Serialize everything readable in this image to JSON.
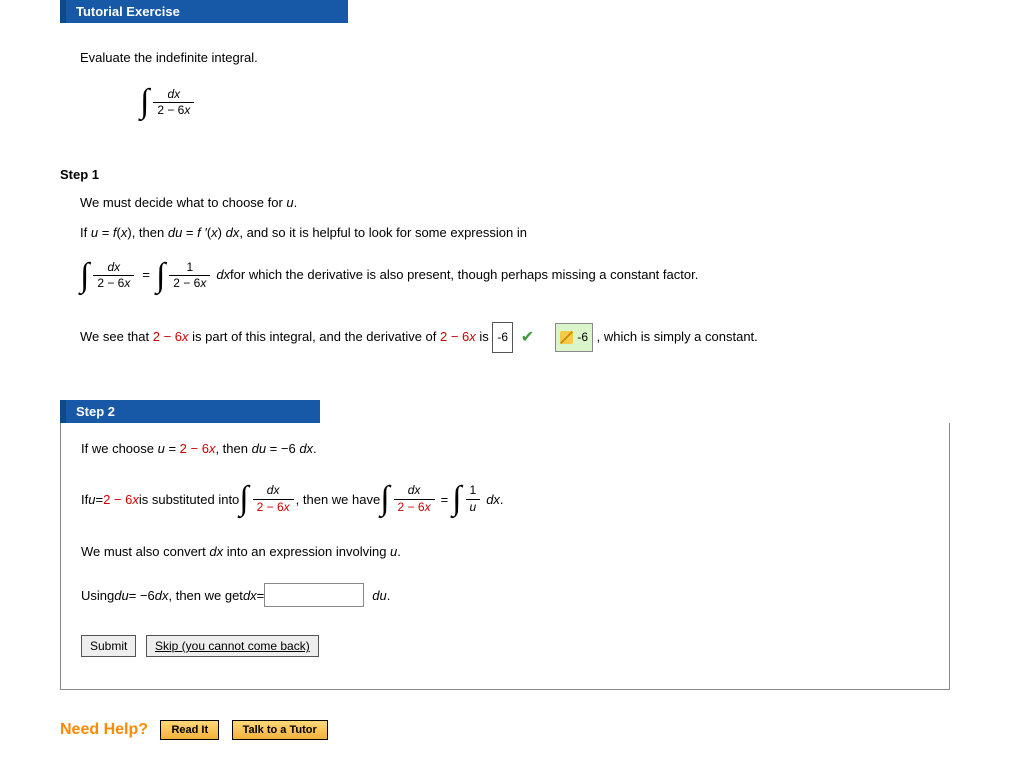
{
  "header": {
    "title": "Tutorial Exercise"
  },
  "intro": {
    "prompt": "Evaluate the indefinite integral.",
    "integral_num": "dx",
    "integral_den_a": "2 − 6",
    "integral_den_x": "x"
  },
  "step1": {
    "label": "Step 1",
    "p1_a": "We must decide what to choose for ",
    "p1_u": "u",
    "p1_b": ".",
    "p2_a": "If  ",
    "p2_u": "u",
    "p2_eq": " = ",
    "p2_f": "f",
    "p2_paren": "(",
    "p2_x": "x",
    "p2_close": "),  then  ",
    "p2_du": "du",
    "p2_eq2": " = ",
    "p2_fp": "f ′",
    "p2_paren2": "(",
    "p2_x2": "x",
    "p2_close2": ") ",
    "p2_dx": "dx",
    "p2_tail": ",  and so it is helpful to look for some expression in",
    "int1_num": "dx",
    "int1_den_a": "2 − 6",
    "int1_den_x": "x",
    "eq_middle": " = ",
    "int2_num": "1",
    "int2_den_a": "2 − 6",
    "int2_den_x": "x",
    "int2_after_dx": "dx",
    "int2_after_text": "  for which the derivative is also present, though perhaps missing a constant factor.",
    "p3_a": "We see that  ",
    "p3_expr_a": "2 − 6",
    "p3_expr_x": "x",
    "p3_b": "  is part of this integral, and the derivative of  ",
    "p3_expr2_a": "2 − 6",
    "p3_expr2_x": "x",
    "p3_c": "  is ",
    "answer_box": "-6",
    "hint_value": "-6",
    "p3_tail": " , which is simply a constant."
  },
  "step2": {
    "label": "Step 2",
    "p1_a": "If we choose  ",
    "p1_u": "u",
    "p1_eq": " = ",
    "p1_expr_a": "2 − 6",
    "p1_expr_x": "x",
    "p1_b": ",  then  ",
    "p1_du": "du",
    "p1_eq2": " = −6 ",
    "p1_dx": "dx",
    "p1_end": ".",
    "p2_a": "If  ",
    "p2_u": "u",
    "p2_eq": " = ",
    "p2_expr_a": "2 − 6",
    "p2_expr_x": "x",
    "p2_b": "  is substituted into  ",
    "p2_int1_num": "dx",
    "p2_int1_den_a": "2 − 6",
    "p2_int1_den_x": "x",
    "p2_mid": ",  then we have  ",
    "p2_int2_num": "dx",
    "p2_int2_den_a": "2 − 6",
    "p2_int2_den_x": "x",
    "p2_eqr": " = ",
    "p2_int3_num": "1",
    "p2_int3_den": "u",
    "p2_int3_dx": "dx",
    "p2_end": ".",
    "p3": "We must also convert  ",
    "p3_dx": "dx",
    "p3_b": "  into an expression involving ",
    "p3_u": "u",
    "p3_end": ".",
    "p4_a": "Using  ",
    "p4_du": "du",
    "p4_eq": " = −6 ",
    "p4_dx": "dx",
    "p4_b": ",  then we get  ",
    "p4_dx2": "dx",
    "p4_eq2": " = ",
    "p4_after": "du",
    "p4_end": ".",
    "submit_label": "Submit",
    "skip_label": "Skip (you cannot come back)"
  },
  "help": {
    "label": "Need Help?",
    "read_label": "Read It",
    "tutor_label": "Talk to a Tutor"
  }
}
